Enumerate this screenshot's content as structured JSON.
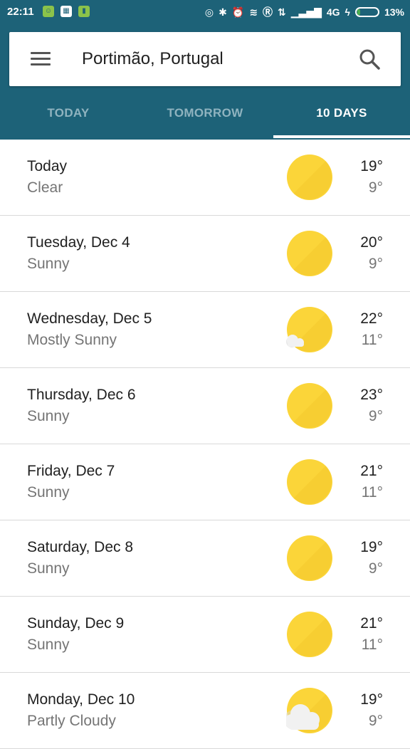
{
  "status_bar": {
    "time": "22:11",
    "network": "4G",
    "battery": "13%"
  },
  "search": {
    "location": "Portimão, Portugal"
  },
  "tabs": [
    {
      "label": "TODAY"
    },
    {
      "label": "TOMORROW"
    },
    {
      "label": "10 DAYS"
    }
  ],
  "active_tab": "10 DAYS",
  "colors": {
    "header": "#1d6278",
    "sun": "#fbd539",
    "cloud": "#f1f1f1"
  },
  "forecast": [
    {
      "day": "Today",
      "condition": "Clear",
      "high": "19°",
      "low": "9°",
      "icon": "sun-icon"
    },
    {
      "day": "Tuesday, Dec 4",
      "condition": "Sunny",
      "high": "20°",
      "low": "9°",
      "icon": "sun-icon"
    },
    {
      "day": "Wednesday, Dec 5",
      "condition": "Mostly Sunny",
      "high": "22°",
      "low": "11°",
      "icon": "mostly-sunny-icon"
    },
    {
      "day": "Thursday, Dec 6",
      "condition": "Sunny",
      "high": "23°",
      "low": "9°",
      "icon": "sun-icon"
    },
    {
      "day": "Friday, Dec 7",
      "condition": "Sunny",
      "high": "21°",
      "low": "11°",
      "icon": "sun-icon"
    },
    {
      "day": "Saturday, Dec 8",
      "condition": "Sunny",
      "high": "19°",
      "low": "9°",
      "icon": "sun-icon"
    },
    {
      "day": "Sunday, Dec 9",
      "condition": "Sunny",
      "high": "21°",
      "low": "11°",
      "icon": "sun-icon"
    },
    {
      "day": "Monday, Dec 10",
      "condition": "Partly Cloudy",
      "high": "19°",
      "low": "9°",
      "icon": "partly-cloudy-icon"
    }
  ]
}
